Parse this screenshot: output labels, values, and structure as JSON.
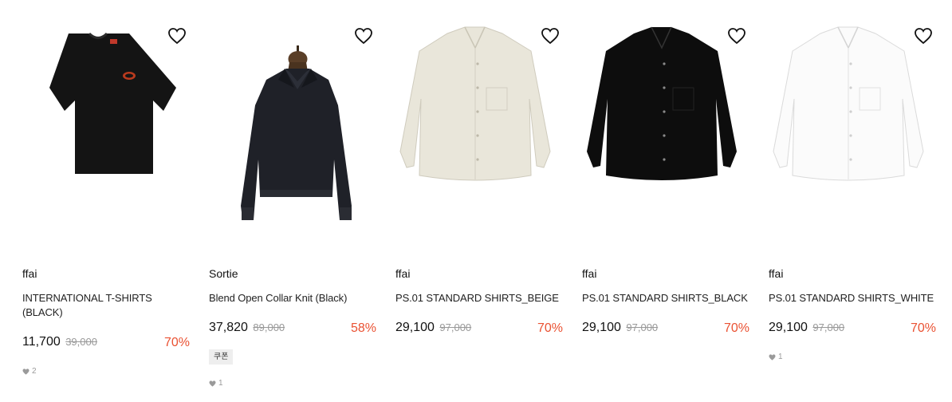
{
  "products": [
    {
      "brand": "ffai",
      "name": "INTERNATIONAL T-SHIRTS (BLACK)",
      "price": "11,700",
      "original_price": "39,000",
      "discount": "70%",
      "likes": "2",
      "image": "black-tshirt"
    },
    {
      "brand": "Sortie",
      "name": "Blend Open Collar Knit (Black)",
      "price": "37,820",
      "original_price": "89,000",
      "discount": "58%",
      "coupon": "쿠폰",
      "likes": "1",
      "image": "black-knit-on-mannequin"
    },
    {
      "brand": "ffai",
      "name": "PS.01 STANDARD SHIRTS_BEIGE",
      "price": "29,100",
      "original_price": "97,000",
      "discount": "70%",
      "image": "beige-shirt"
    },
    {
      "brand": "ffai",
      "name": "PS.01 STANDARD SHIRTS_BLACK",
      "price": "29,100",
      "original_price": "97,000",
      "discount": "70%",
      "image": "black-shirt"
    },
    {
      "brand": "ffai",
      "name": "PS.01 STANDARD SHIRTS_WHITE",
      "price": "29,100",
      "original_price": "97,000",
      "discount": "70%",
      "likes": "1",
      "image": "white-shirt"
    }
  ],
  "colors": {
    "discount": "#ea5233",
    "original_price": "#999999",
    "likes": "#9a9a9a",
    "coupon_bg": "#eeeeee"
  },
  "icons": {
    "wishlist": "heart-outline-icon",
    "likes": "heart-filled-icon"
  }
}
